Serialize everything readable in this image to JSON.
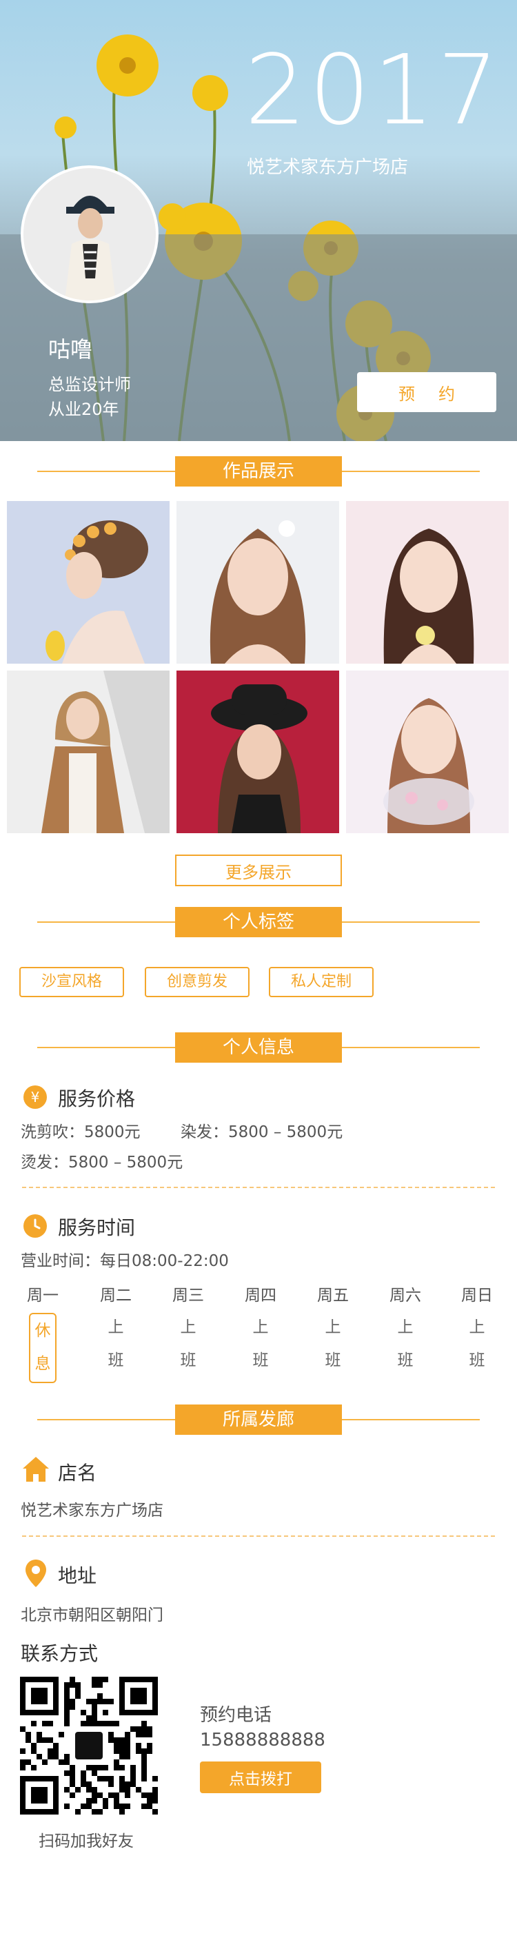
{
  "hero": {
    "year": "2017",
    "store": "悦艺术家东方广场店",
    "name": "咕噜",
    "title": "总监设计师",
    "experience": "从业20年",
    "book_label": "预约"
  },
  "sections": {
    "works": "作品展示",
    "tags": "个人标签",
    "info": "个人信息",
    "salon": "所属发廊"
  },
  "gallery": {
    "more_label": "更多展示"
  },
  "tags": [
    "沙宣风格",
    "创意剪发",
    "私人定制"
  ],
  "price": {
    "icon": "yen-icon",
    "heading": "服务价格",
    "wash_cut": "洗剪吹：5800元",
    "dye": "染发：5800 – 5800元",
    "perm": "烫发：5800 – 5800元"
  },
  "time": {
    "icon": "clock-icon",
    "heading": "服务时间",
    "hours": "营业时间：每日08:00-22:00",
    "days": [
      "周一",
      "周二",
      "周三",
      "周四",
      "周五",
      "周六",
      "周日"
    ],
    "status": [
      [
        "休",
        "息"
      ],
      [
        "上",
        "班"
      ],
      [
        "上",
        "班"
      ],
      [
        "上",
        "班"
      ],
      [
        "上",
        "班"
      ],
      [
        "上",
        "班"
      ],
      [
        "上",
        "班"
      ]
    ]
  },
  "salon": {
    "name_heading": "店名",
    "name": "悦艺术家东方广场店",
    "address_heading": "地址",
    "address": "北京市朝阳区朝阳门",
    "contact_heading": "联系方式",
    "qr_caption": "扫码加我好友",
    "phone_label": "预约电话",
    "phone": "15888888888",
    "call_label": "点击拨打"
  },
  "colors": {
    "accent": "#f4a62a",
    "accent_light": "#f7b543"
  }
}
